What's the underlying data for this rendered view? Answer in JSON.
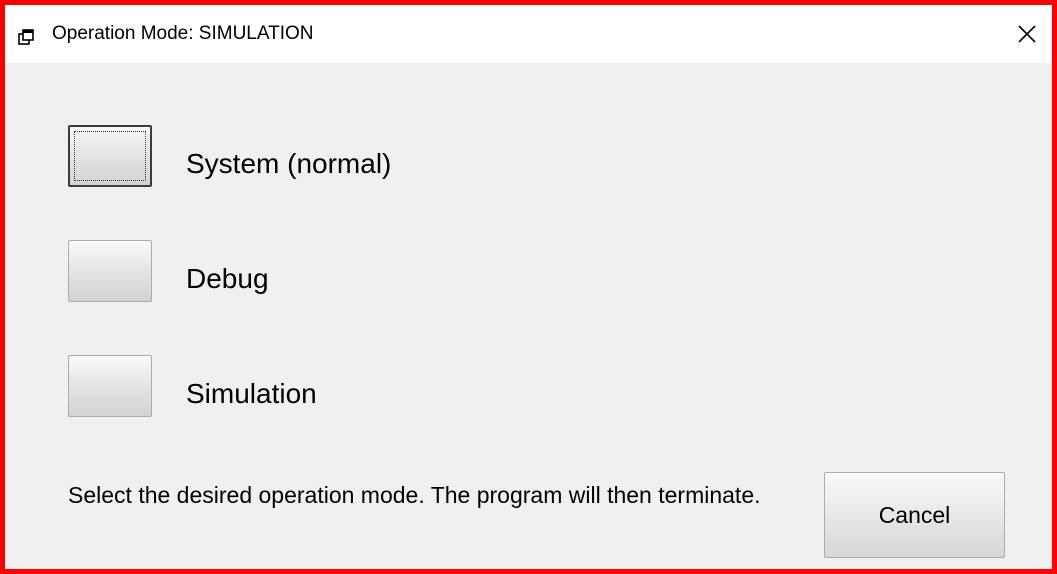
{
  "window": {
    "title": "Operation Mode: SIMULATION",
    "title_icon": "app-window-icon",
    "close_icon": "close-icon",
    "accent_border_color": "#ff0000"
  },
  "modes": [
    {
      "label": "System (normal)",
      "focused": true
    },
    {
      "label": "Debug",
      "focused": false
    },
    {
      "label": "Simulation",
      "focused": false
    }
  ],
  "instruction_text": "Select the desired operation mode. The program will then terminate.",
  "cancel_label": "Cancel"
}
